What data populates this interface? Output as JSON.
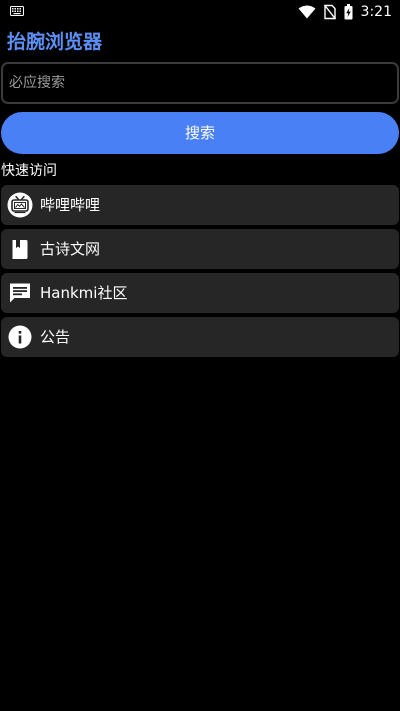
{
  "status_bar": {
    "time": "3:21",
    "icons": [
      "keyboard-icon",
      "wifi-icon",
      "no-sim-icon",
      "battery-charging-icon"
    ]
  },
  "app": {
    "title": "抬腕浏览器"
  },
  "search": {
    "placeholder": "必应搜索",
    "value": "",
    "button_label": "搜索"
  },
  "quick_access": {
    "label": "快速访问",
    "items": [
      {
        "label": "哔哩哔哩",
        "icon": "bilibili-tv-icon"
      },
      {
        "label": "古诗文网",
        "icon": "book-icon"
      },
      {
        "label": "Hankmi社区",
        "icon": "chat-message-icon"
      },
      {
        "label": "公告",
        "icon": "info-icon"
      }
    ]
  },
  "colors": {
    "background": "#000000",
    "accent": "#4a80f5",
    "title": "#5b8ff5",
    "item_background": "#262626",
    "input_border": "#3a3a3a"
  }
}
